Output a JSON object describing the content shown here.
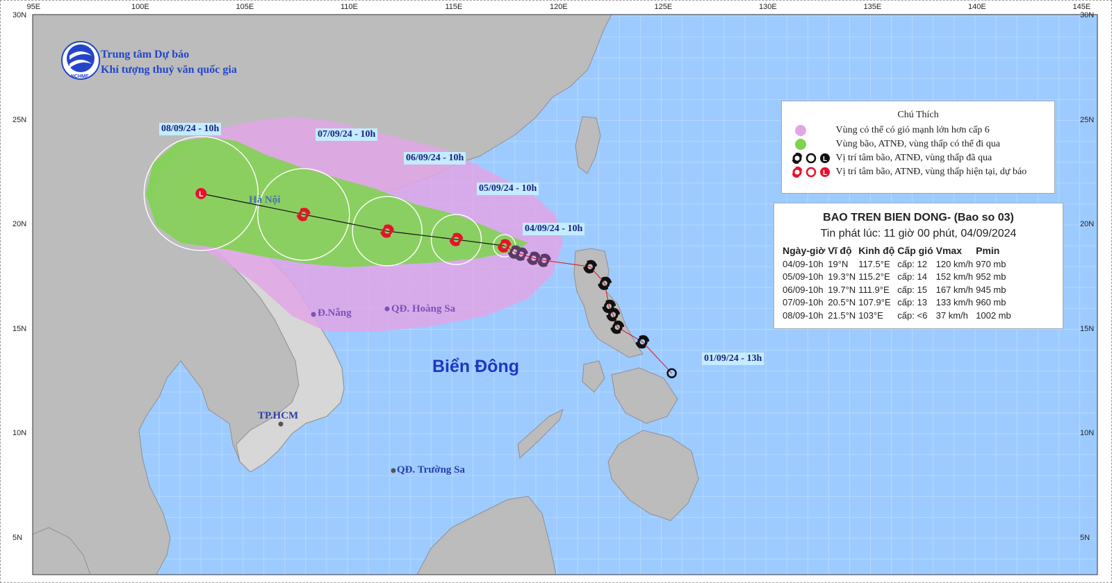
{
  "organization": {
    "line1": "Trung tâm Dự báo",
    "line2": "Khí tượng thuỷ văn quốc gia",
    "logo_text": "NCHMF"
  },
  "axes": {
    "top": [
      "95E",
      "100E",
      "105E",
      "110E",
      "115E",
      "120E",
      "125E",
      "130E",
      "135E",
      "140E",
      "145E"
    ],
    "left": [
      "30N",
      "25N",
      "20N",
      "15N",
      "10N",
      "5N"
    ],
    "right": [
      "30N",
      "25N",
      "20N",
      "15N",
      "10N",
      "5N"
    ]
  },
  "sea_label": "Biển Đông",
  "capital_label": "Hà Nội",
  "places": {
    "danang": "Đ.Nẵng",
    "hoangsa": "QĐ. Hoàng Sa",
    "truongsa": "QĐ. Trường Sa",
    "hcm": "TP.HCM"
  },
  "time_labels": {
    "d0809": "08/09/24 - 10h",
    "d0709": "07/09/24 - 10h",
    "d0609": "06/09/24 - 10h",
    "d0509": "05/09/24 - 10h",
    "d0409": "04/09/24 - 10h",
    "d0109": "01/09/24 - 13h"
  },
  "legend": {
    "title": "Chú Thích",
    "items": [
      {
        "text": "Vùng có thể có gió mạnh lớn hơn cấp 6",
        "symbol": "pink-dot-icon"
      },
      {
        "text": "Vùng bão, ATNĐ, vùng thấp có thể đi qua",
        "symbol": "green-dot-icon"
      },
      {
        "text": "Vị trí tâm bão, ATNĐ, vùng thấp đã qua",
        "symbol": "black-storm-icons"
      },
      {
        "text": "Vị trí tâm bão, ATNĐ, vùng thấp hiện tại, dự báo",
        "symbol": "red-storm-icons"
      }
    ]
  },
  "bulletin": {
    "title": "BAO TREN BIEN DONG- (Bao so 03)",
    "issued": "Tin phát lúc: 11 giờ 00 phút, 04/09/2024",
    "headers": [
      "Ngày-giờ",
      "Vĩ độ",
      "Kinh độ",
      "Cấp gió",
      "Vmax",
      "Pmin"
    ],
    "rows": [
      [
        "04/09-10h",
        "19°N",
        "117.5°E",
        "cấp: 12",
        "120 km/h",
        "970 mb"
      ],
      [
        "05/09-10h",
        "19.3°N",
        "115.2°E",
        "cấp: 14",
        "152 km/h",
        "952 mb"
      ],
      [
        "06/09-10h",
        "19.7°N",
        "111.9°E",
        "cấp: 15",
        "167 km/h",
        "945 mb"
      ],
      [
        "07/09-10h",
        "20.5°N",
        "107.9°E",
        "cấp: 13",
        "133 km/h",
        "960 mb"
      ],
      [
        "08/09-10h",
        "21.5°N",
        "103°E",
        "cấp: <6",
        "37 km/h",
        "1002 mb"
      ]
    ]
  },
  "track": {
    "forecast": [
      {
        "time": "04/09-10h",
        "lat": 19.0,
        "lon": 117.5
      },
      {
        "time": "05/09-10h",
        "lat": 19.3,
        "lon": 115.2
      },
      {
        "time": "06/09-10h",
        "lat": 19.7,
        "lon": 111.9
      },
      {
        "time": "07/09-10h",
        "lat": 20.5,
        "lon": 107.9
      },
      {
        "time": "08/09-10h",
        "lat": 21.5,
        "lon": 103.0
      }
    ],
    "past": [
      {
        "lat": 18.7,
        "lon": 118.0
      },
      {
        "lat": 18.6,
        "lon": 118.3
      },
      {
        "lat": 18.4,
        "lon": 118.9
      },
      {
        "lat": 18.3,
        "lon": 119.4
      },
      {
        "lat": 18.0,
        "lon": 121.6
      },
      {
        "lat": 17.2,
        "lon": 122.3
      },
      {
        "lat": 16.1,
        "lon": 122.5
      },
      {
        "lat": 15.7,
        "lon": 122.7
      },
      {
        "lat": 15.1,
        "lon": 122.9
      },
      {
        "lat": 14.4,
        "lon": 124.1
      },
      {
        "lat": 12.9,
        "lon": 125.5
      }
    ]
  },
  "colors": {
    "ocean": "#9dcbff",
    "land": "#bcbcbc",
    "pink_zone": "#e2a6e6",
    "green_zone": "#7cd54a",
    "track_red": "#e8112d",
    "past_black": "#111111"
  }
}
